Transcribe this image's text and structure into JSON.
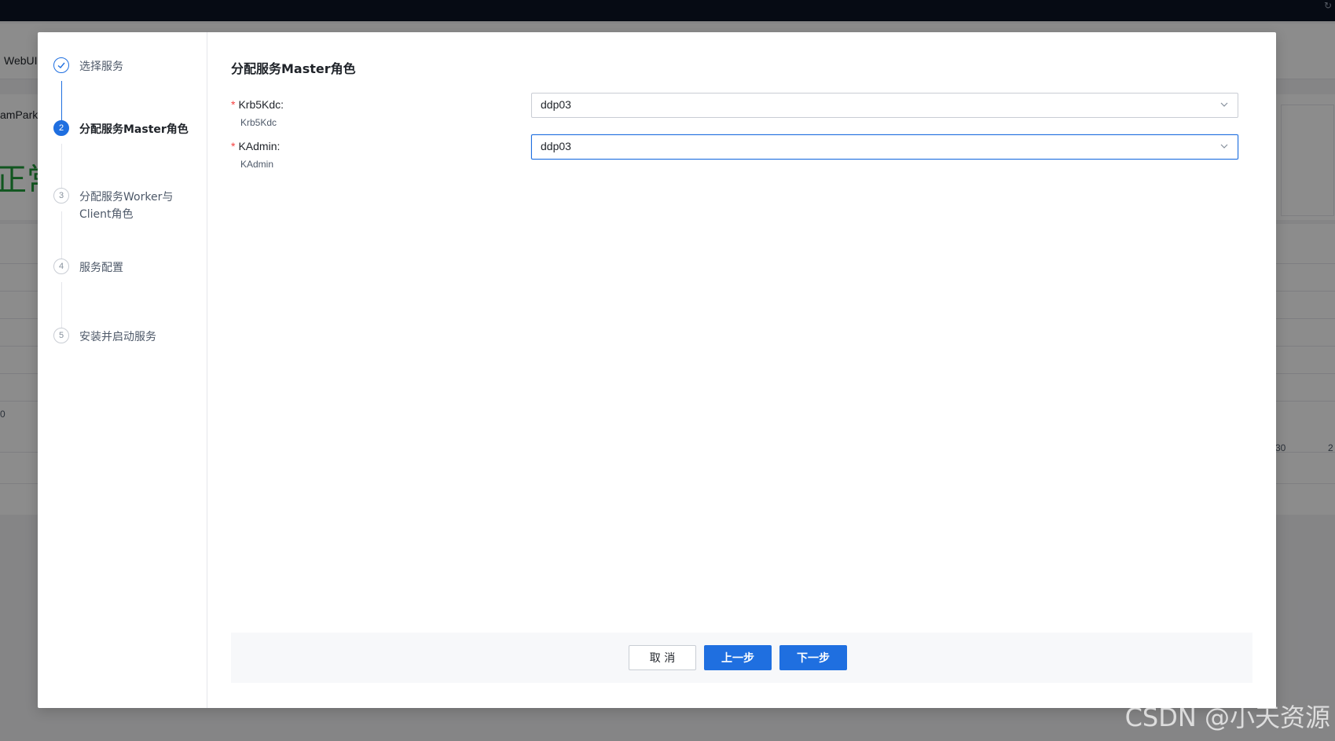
{
  "background": {
    "webui_label": "WebUI",
    "park_label": "amPark:",
    "status_text": "正常",
    "axis_zero": "0",
    "axis_thirty": "30",
    "axis_two": "2"
  },
  "steps": [
    {
      "number": "",
      "label": "选择服务",
      "state": "done"
    },
    {
      "number": "2",
      "label": "分配服务Master角色",
      "state": "active"
    },
    {
      "number": "3",
      "label": "分配服务Worker与Client角色",
      "state": "todo"
    },
    {
      "number": "4",
      "label": "服务配置",
      "state": "todo"
    },
    {
      "number": "5",
      "label": "安装并启动服务",
      "state": "todo"
    }
  ],
  "content": {
    "title": "分配服务Master角色",
    "fields": [
      {
        "required_mark": "*",
        "label": "Krb5Kdc:",
        "sublabel": "Krb5Kdc",
        "value": "ddp03"
      },
      {
        "required_mark": "*",
        "label": "KAdmin:",
        "sublabel": "KAdmin",
        "value": "ddp03"
      }
    ]
  },
  "footer": {
    "cancel_label": "取 消",
    "prev_label": "上一步",
    "next_label": "下一步"
  },
  "watermark": "CSDN @小天资源",
  "colors": {
    "primary": "#1f6fe0",
    "required": "#f53f3f",
    "status_green": "#1f9d3a"
  }
}
